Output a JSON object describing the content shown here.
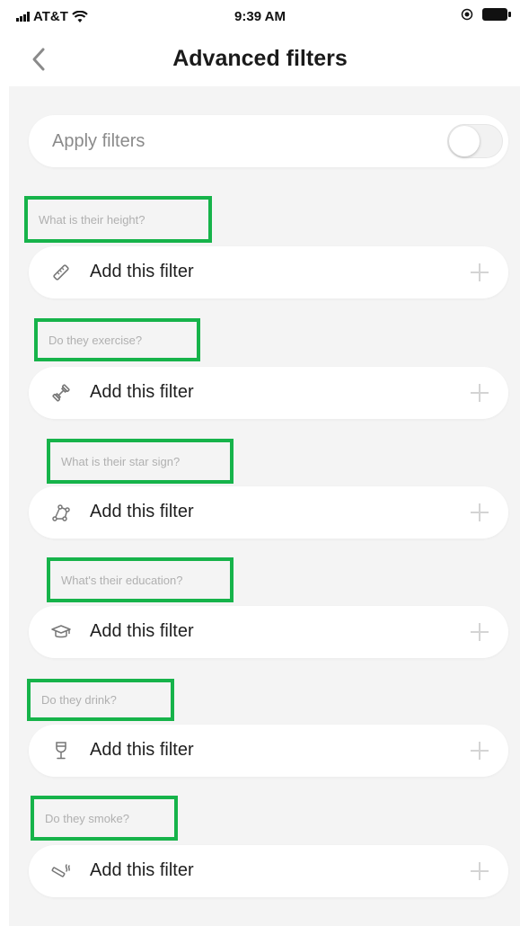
{
  "status_bar": {
    "carrier": "AT&T",
    "time": "9:39 AM"
  },
  "nav": {
    "title": "Advanced filters",
    "back_icon": "chevron-left-icon"
  },
  "apply_filters": {
    "label": "Apply filters",
    "enabled": false
  },
  "sections": [
    {
      "question": "What is their height?",
      "action": "Add this filter",
      "icon": "ruler-icon"
    },
    {
      "question": "Do they exercise?",
      "action": "Add this filter",
      "icon": "dumbbell-icon"
    },
    {
      "question": "What is their star sign?",
      "action": "Add this filter",
      "icon": "constellation-icon"
    },
    {
      "question": "What's their education?",
      "action": "Add this filter",
      "icon": "graduation-cap-icon"
    },
    {
      "question": "Do they drink?",
      "action": "Add this filter",
      "icon": "wine-glass-icon"
    },
    {
      "question": "Do they smoke?",
      "action": "Add this filter",
      "icon": "cigarette-icon"
    }
  ],
  "colors": {
    "highlight_box": "#16b34a",
    "background": "#f4f4f4",
    "card": "#ffffff",
    "label_gray": "#b0b0b0"
  }
}
